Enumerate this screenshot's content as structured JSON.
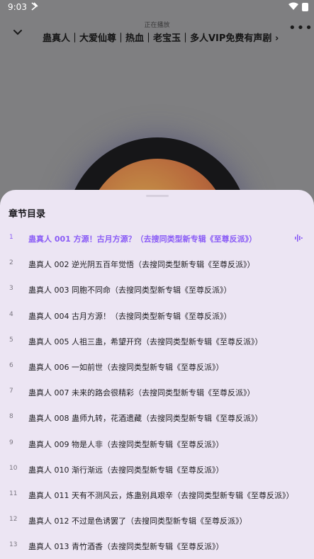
{
  "status_bar": {
    "time": "9:03"
  },
  "header": {
    "now_playing": "正在播放",
    "title": "蛊真人｜大爱仙尊｜热血｜老宝玉｜多人VIP免费有声剧 ›"
  },
  "sheet": {
    "title": "章节目录",
    "chapters": [
      {
        "num": "1",
        "label": "蛊真人 001 方源！古月方源？（去搜同类型新专辑《至尊反派》）",
        "active": true
      },
      {
        "num": "2",
        "label": "蛊真人 002 逆光阴五百年觉悟（去搜同类型新专辑《至尊反派》）"
      },
      {
        "num": "3",
        "label": "蛊真人 003 同胞不同命（去搜同类型新专辑《至尊反派》）"
      },
      {
        "num": "4",
        "label": "蛊真人 004 古月方源！（去搜同类型新专辑《至尊反派》）"
      },
      {
        "num": "5",
        "label": "蛊真人 005 人祖三蛊，希望开窍（去搜同类型新专辑《至尊反派》）"
      },
      {
        "num": "6",
        "label": "蛊真人 006 一如前世（去搜同类型新专辑《至尊反派》）"
      },
      {
        "num": "7",
        "label": "蛊真人 007 未来的路会很精彩（去搜同类型新专辑《至尊反派》）"
      },
      {
        "num": "8",
        "label": "蛊真人 008 蛊师九转，花酒遗藏（去搜同类型新专辑《至尊反派》）"
      },
      {
        "num": "9",
        "label": "蛊真人 009 物是人非（去搜同类型新专辑《至尊反派》）"
      },
      {
        "num": "10",
        "label": "蛊真人 010 渐行渐远（去搜同类型新专辑《至尊反派》）"
      },
      {
        "num": "11",
        "label": "蛊真人 011 天有不测风云，炼蛊别具艰辛（去搜同类型新专辑《至尊反派》）"
      },
      {
        "num": "12",
        "label": "蛊真人 012 不过是色诱罢了（去搜同类型新专辑《至尊反派》）"
      },
      {
        "num": "13",
        "label": "蛊真人 013 青竹酒香（去搜同类型新专辑《至尊反派》）"
      }
    ]
  },
  "colors": {
    "accent": "#8a5cf6",
    "sheet_bg": "#ece5f3",
    "backdrop": "#7f7f81"
  }
}
